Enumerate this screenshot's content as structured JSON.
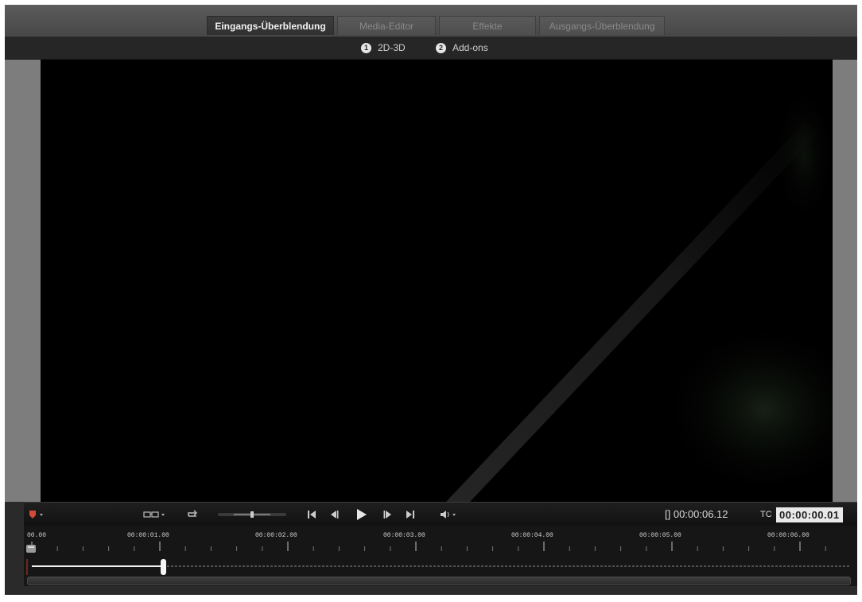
{
  "tabs": [
    {
      "label": "Eingangs-Überblendung",
      "active": true
    },
    {
      "label": "Media-Editor",
      "active": false
    },
    {
      "label": "Effekte",
      "active": false
    },
    {
      "label": "Ausgangs-Überblendung",
      "active": false
    }
  ],
  "subtabs": [
    {
      "number": "1",
      "label": "2D-3D"
    },
    {
      "number": "2",
      "label": "Add-ons"
    }
  ],
  "player": {
    "duration": "[] 00:00:06.12",
    "tc_label": "TC",
    "timecode": "00:00:00.01",
    "progress": 0.16
  },
  "ruler": {
    "labels": [
      "00.00",
      "00:00:01.00",
      "00:00:02.00",
      "00:00:03.00",
      "00:00:04.00",
      "00:00:05.00",
      "00:00:06.00"
    ]
  },
  "icons": {
    "marker": "red-shield-icon",
    "glasses": "3d-glasses-icon",
    "loop": "loop-icon",
    "shuttle": "shuttle-slider",
    "skip_start": "skip-to-start-icon",
    "step_back": "step-back-icon",
    "play": "play-icon",
    "step_forward": "step-forward-icon",
    "skip_end": "skip-to-end-icon",
    "volume": "volume-icon"
  },
  "colors": {
    "accent_red": "#d24a3a",
    "background": "#2a2a2a",
    "tab_active_text": "#f2f2f2"
  }
}
